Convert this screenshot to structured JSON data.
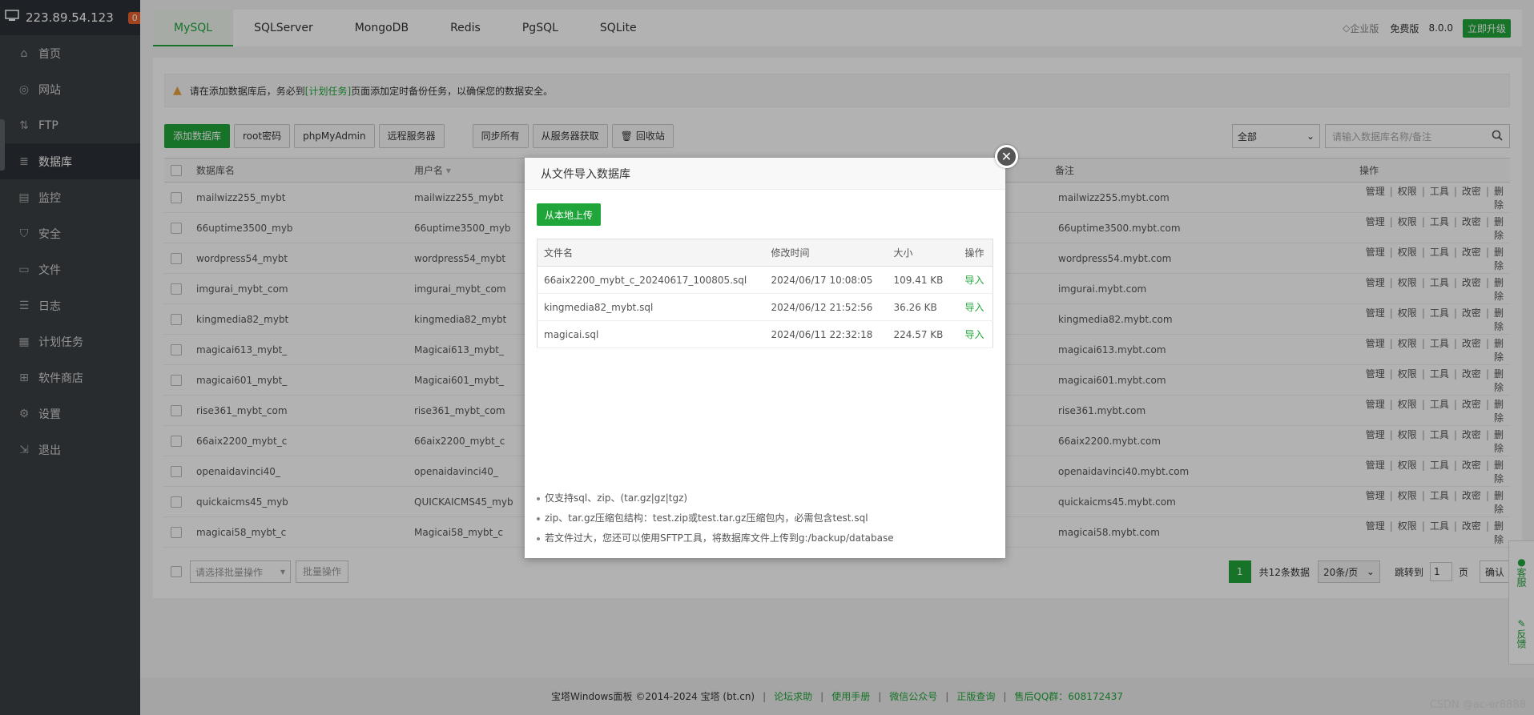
{
  "sidebar": {
    "ip": "223.89.54.123",
    "badge": "0",
    "items": [
      {
        "label": "首页",
        "icon": "home-icon"
      },
      {
        "label": "网站",
        "icon": "globe-icon"
      },
      {
        "label": "FTP",
        "icon": "ftp-icon"
      },
      {
        "label": "数据库",
        "icon": "database-icon"
      },
      {
        "label": "监控",
        "icon": "monitor-icon"
      },
      {
        "label": "安全",
        "icon": "shield-icon"
      },
      {
        "label": "文件",
        "icon": "folder-icon"
      },
      {
        "label": "日志",
        "icon": "log-icon"
      },
      {
        "label": "计划任务",
        "icon": "calendar-icon"
      },
      {
        "label": "软件商店",
        "icon": "grid-icon"
      },
      {
        "label": "设置",
        "icon": "gear-icon"
      },
      {
        "label": "退出",
        "icon": "logout-icon"
      }
    ]
  },
  "tabs": [
    "MySQL",
    "SQLServer",
    "MongoDB",
    "Redis",
    "PgSQL",
    "SQLite"
  ],
  "topright": {
    "enterprise": "企业版",
    "free": "免费版",
    "version": "8.0.0",
    "upgrade": "立即升级"
  },
  "notice": {
    "pre": "请在添加数据库后，务必到",
    "link": "[计划任务]",
    "post": "页面添加定时备份任务，以确保您的数据安全。"
  },
  "toolbar": {
    "add": "添加数据库",
    "root": "root密码",
    "pma": "phpMyAdmin",
    "remote": "远程服务器",
    "sync": "同步所有",
    "fetch": "从服务器获取",
    "recycle": "回收站",
    "filter": "全部",
    "search_placeholder": "请输入数据库名称/备注"
  },
  "table": {
    "headers": {
      "name": "数据库名",
      "user": "用户名",
      "remark": "备注",
      "ops": "操作"
    },
    "ops": [
      "管理",
      "权限",
      "工具",
      "改密",
      "删除"
    ],
    "rows": [
      {
        "name": "mailwizz255_mybt",
        "user": "mailwizz255_mybt",
        "remark": "mailwizz255.mybt.com"
      },
      {
        "name": "66uptime3500_myb",
        "user": "66uptime3500_myb",
        "remark": "66uptime3500.mybt.com"
      },
      {
        "name": "wordpress54_mybt",
        "user": "wordpress54_mybt",
        "remark": "wordpress54.mybt.com"
      },
      {
        "name": "imgurai_mybt_com",
        "user": "imgurai_mybt_com",
        "remark": "imgurai.mybt.com"
      },
      {
        "name": "kingmedia82_mybt",
        "user": "kingmedia82_mybt",
        "remark": "kingmedia82.mybt.com"
      },
      {
        "name": "magicai613_mybt_",
        "user": "Magicai613_mybt_",
        "remark": "magicai613.mybt.com"
      },
      {
        "name": "magicai601_mybt_",
        "user": "Magicai601_mybt_",
        "remark": "magicai601.mybt.com"
      },
      {
        "name": "rise361_mybt_com",
        "user": "rise361_mybt_com",
        "remark": "rise361.mybt.com"
      },
      {
        "name": "66aix2200_mybt_c",
        "user": "66aix2200_mybt_c",
        "remark": "66aix2200.mybt.com"
      },
      {
        "name": "openaidavinci40_",
        "user": "openaidavinci40_",
        "remark": "openaidavinci40.mybt.com"
      },
      {
        "name": "quickaicms45_myb",
        "user": "QUICKAICMS45_myb",
        "remark": "quickaicms45.mybt.com"
      },
      {
        "name": "magicai58_mybt_c",
        "user": "Magicai58_mybt_c",
        "remark": "magicai58.mybt.com"
      }
    ]
  },
  "footer": {
    "batch_select": "请选择批量操作",
    "batch_btn": "批量操作",
    "page": "1",
    "total": "共12条数据",
    "per_page": "20条/页",
    "jump_label": "跳转到",
    "jump_value": "1",
    "page_unit": "页",
    "confirm": "确认"
  },
  "copyright": {
    "text": "宝塔Windows面板 ©2014-2024 宝塔 (bt.cn)",
    "links": [
      "论坛求助",
      "使用手册",
      "微信公众号",
      "正版查询",
      "售后QQ群：608172437"
    ]
  },
  "side_float": {
    "service": "客服",
    "feedback": "反馈"
  },
  "watermark": "CSDN @ac-er8888",
  "modal": {
    "title": "从文件导入数据库",
    "upload": "从本地上传",
    "headers": {
      "file": "文件名",
      "time": "修改时间",
      "size": "大小",
      "op": "操作"
    },
    "files": [
      {
        "file": "66aix2200_mybt_c_20240617_100805.sql",
        "time": "2024/06/17 10:08:05",
        "size": "109.41 KB",
        "op": "导入"
      },
      {
        "file": "kingmedia82_mybt.sql",
        "time": "2024/06/12 21:52:56",
        "size": "36.26 KB",
        "op": "导入"
      },
      {
        "file": "magicai.sql",
        "time": "2024/06/11 22:32:18",
        "size": "224.57 KB",
        "op": "导入"
      }
    ],
    "tips": [
      "仅支持sql、zip、(tar.gz|gz|tgz)",
      "zip、tar.gz压缩包结构：test.zip或test.tar.gz压缩包内，必需包含test.sql",
      "若文件过大，您还可以使用SFTP工具，将数据库文件上传到g:/backup/database"
    ]
  },
  "colors": {
    "accent": "#20a53a",
    "sidebar": "#3a3f44",
    "warning": "#e6a23c"
  }
}
